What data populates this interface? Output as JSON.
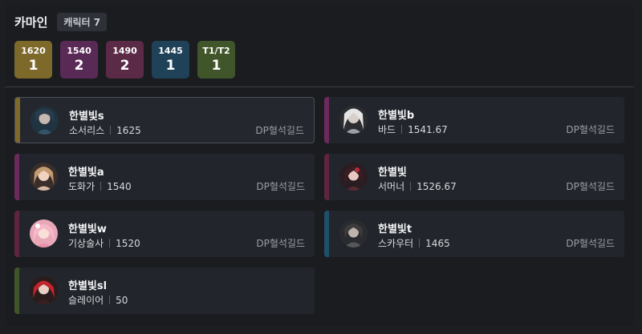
{
  "header": {
    "title": "카마인",
    "char_badge": "캐릭터 7"
  },
  "tiers": [
    {
      "level": "1620",
      "count": "1",
      "color": "#7d6a2b"
    },
    {
      "level": "1540",
      "count": "2",
      "color": "#5a2a57"
    },
    {
      "level": "1490",
      "count": "2",
      "color": "#5a2a47"
    },
    {
      "level": "1445",
      "count": "1",
      "color": "#1f4259"
    },
    {
      "level": "T1/T2",
      "count": "1",
      "color": "#40562a"
    }
  ],
  "characters": [
    {
      "name": "한별빛s",
      "class": "소서리스",
      "item_level": "1625",
      "guild": "DP혈석길드",
      "accent": "#7d6a2b",
      "selected": true
    },
    {
      "name": "한별빛b",
      "class": "바드",
      "item_level": "1541.67",
      "guild": "DP혈석길드",
      "accent": "#6b2a5c"
    },
    {
      "name": "한별빛a",
      "class": "도화가",
      "item_level": "1540",
      "guild": "DP혈석길드",
      "accent": "#6b2a5c"
    },
    {
      "name": "한별빛",
      "class": "서머너",
      "item_level": "1526.67",
      "guild": "DP혈석길드",
      "accent": "#5e2440"
    },
    {
      "name": "한별빛w",
      "class": "기상술사",
      "item_level": "1520",
      "guild": "DP혈석길드",
      "accent": "#5e2440"
    },
    {
      "name": "한별빛t",
      "class": "스카우터",
      "item_level": "1465",
      "guild": "DP혈석길드",
      "accent": "#1f4f6a"
    },
    {
      "name": "한별빛sl",
      "class": "슬레이어",
      "item_level": "50",
      "guild": "",
      "accent": "#40562a"
    }
  ]
}
